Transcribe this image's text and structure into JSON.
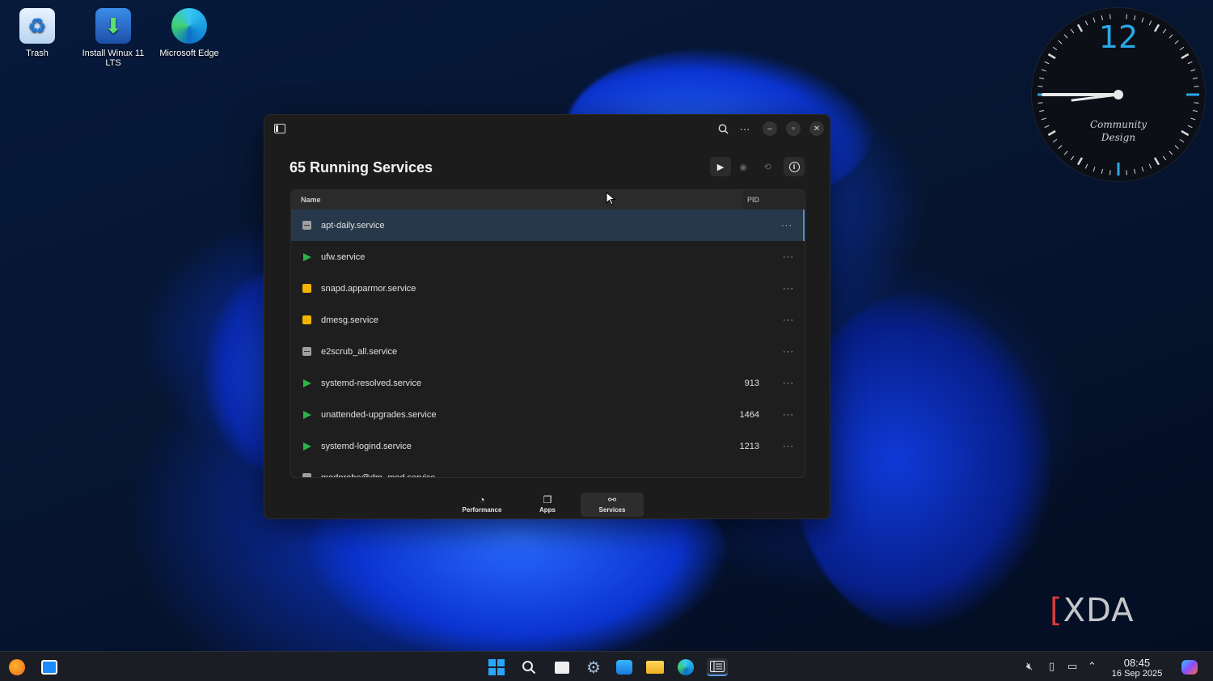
{
  "desktop": {
    "icons": [
      {
        "label": "Trash",
        "icon": "recycle-bin-icon"
      },
      {
        "label": "Install Winux 11 LTS",
        "icon": "download-icon"
      },
      {
        "label": "Microsoft Edge",
        "icon": "edge-icon"
      }
    ]
  },
  "clock_widget": {
    "hour_label": "12",
    "brand_line1": "Community",
    "brand_line2": "Design"
  },
  "window": {
    "title": "65 Running Services",
    "table": {
      "columns": [
        "Name",
        "PID"
      ],
      "rows": [
        {
          "name": "apt-daily.service",
          "pid": "",
          "status": "stopped"
        },
        {
          "name": "ufw.service",
          "pid": "",
          "status": "running"
        },
        {
          "name": "snapd.apparmor.service",
          "pid": "",
          "status": "warning"
        },
        {
          "name": "dmesg.service",
          "pid": "",
          "status": "warning"
        },
        {
          "name": "e2scrub_all.service",
          "pid": "",
          "status": "stopped"
        },
        {
          "name": "systemd-resolved.service",
          "pid": "913",
          "status": "running"
        },
        {
          "name": "unattended-upgrades.service",
          "pid": "1464",
          "status": "running"
        },
        {
          "name": "systemd-logind.service",
          "pid": "1213",
          "status": "running"
        },
        {
          "name": "modprobe@dm_mod.service",
          "pid": "",
          "status": "stopped"
        }
      ],
      "more_label": "···"
    },
    "nav": [
      {
        "label": "Performance",
        "icon": "gauge-icon"
      },
      {
        "label": "Apps",
        "icon": "apps-icon"
      },
      {
        "label": "Services",
        "icon": "services-icon",
        "active": true
      }
    ]
  },
  "watermark": {
    "text": "XDA"
  },
  "taskbar": {
    "time": "08:45",
    "date": "16 Sep 2025"
  },
  "colors": {
    "running": "#2bb34a",
    "warning": "#f2b400",
    "stopped": "#9e9e9e",
    "selected_row": "#27384a",
    "accent": "#2aa7ea"
  }
}
